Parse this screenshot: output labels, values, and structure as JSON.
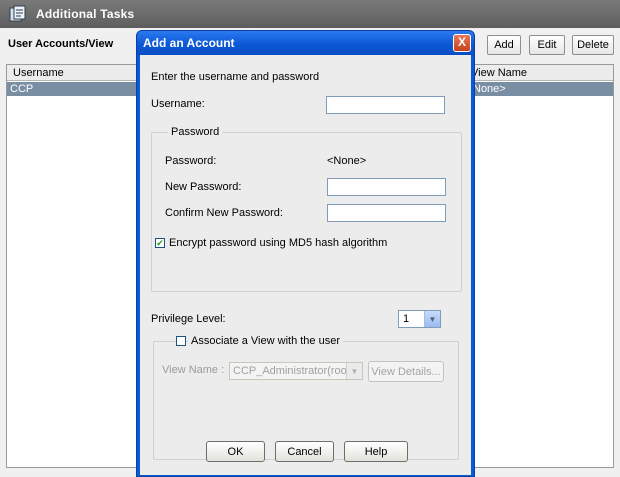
{
  "app": {
    "title": "Additional Tasks",
    "heading": "User Accounts/View",
    "buttons": {
      "add": "Add",
      "edit": "Edit",
      "delete": "Delete"
    },
    "table": {
      "columns": [
        "Username",
        "View Name"
      ],
      "rows": [
        {
          "username": "CCP",
          "view_name": "None>"
        }
      ]
    }
  },
  "dialog": {
    "title": "Add an Account",
    "close_label": "X",
    "instruction": "Enter the username and password",
    "username_label": "Username:",
    "username_value": "",
    "password_group": {
      "legend": "Password",
      "password_label": "Password:",
      "password_value": "<None>",
      "new_password_label": "New Password:",
      "new_password_value": "",
      "confirm_label": "Confirm New Password:",
      "confirm_value": ""
    },
    "encrypt": {
      "checked": true,
      "label": "Encrypt password using MD5 hash algorithm"
    },
    "privilege": {
      "label": "Privilege Level:",
      "value": "1"
    },
    "view_group": {
      "associate_checked": false,
      "associate_label": "Associate a View with the user",
      "view_name_label": "View Name :",
      "view_name_value": "CCP_Administrator(root)",
      "view_details_label": "View Details..."
    },
    "buttons": {
      "ok": "OK",
      "cancel": "Cancel",
      "help": "Help"
    }
  },
  "colors": {
    "dialog_frame": "#0a5bd6",
    "selected_row": "#7a8ea3",
    "close_button": "#c5401c"
  },
  "icons": {
    "app": "tasks-icon",
    "close": "close-icon",
    "checkmark": "checkmark-icon",
    "dropdown": "chevron-down-icon"
  }
}
